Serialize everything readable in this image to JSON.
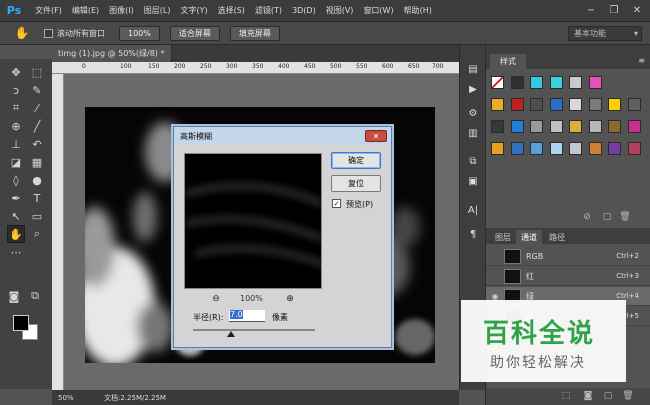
{
  "app": {
    "logo": "Ps"
  },
  "menu": [
    "文件(F)",
    "编辑(E)",
    "图像(I)",
    "图层(L)",
    "文字(Y)",
    "选择(S)",
    "滤镜(T)",
    "3D(D)",
    "视图(V)",
    "窗口(W)",
    "帮助(H)"
  ],
  "window_controls": {
    "minimize": "−",
    "restore": "❐",
    "close": "✕"
  },
  "options_bar": {
    "scroll_all_windows": "滚动所有窗口",
    "scroll_all_checked": false,
    "zoom_100": "100%",
    "fit_screen": "适合屏幕",
    "fill_screen": "填充屏幕",
    "workspace": "基本功能"
  },
  "document": {
    "tab_title": "timg (1).jpg @ 50%(绿/8) *",
    "tab_close": "×",
    "ruler_marks": [
      "0",
      "100",
      "150",
      "200",
      "250",
      "300",
      "350",
      "400",
      "450",
      "500",
      "550",
      "600",
      "650",
      "700",
      "750"
    ],
    "zoom": "50%",
    "doc_size": "文档:2.25M/2.25M"
  },
  "dialog": {
    "title": "高斯模糊",
    "close": "✕",
    "ok": "确定",
    "reset": "复位",
    "preview_label": "预览(P)",
    "preview_checked": true,
    "zoom_percent": "100%",
    "radius_label": "半径(R):",
    "radius_value": "7.0",
    "radius_unit": "像素"
  },
  "styles_panel": {
    "tab": "样式",
    "menu_icon": "≡",
    "swatch_colors": [
      "#ffffff",
      "#303030",
      "#36c6e8",
      "#3fd0e0",
      "#c9c9c9",
      "#e84fb8",
      "#e8b020",
      "#c02020",
      "#4f4f4f",
      "#2a6fc8",
      "#d8d8d8",
      "#7a7a7a",
      "#ffd000",
      "#606060",
      "#383838",
      "#2080d8",
      "#9a9a9a",
      "#c0c0c0",
      "#d8b040",
      "#b8b8b8",
      "#8a6a30",
      "#c83090",
      "#e8a020",
      "#3070c0",
      "#5aa0d8",
      "#a8d8f0",
      "#c0c8d0",
      "#d08030",
      "#7040a0",
      "#b04060"
    ]
  },
  "channels_panel": {
    "tabs": [
      "图层",
      "通道",
      "路径"
    ],
    "active_tab": 1,
    "channels": [
      {
        "name": "RGB",
        "shortcut": "Ctrl+2",
        "visible": false
      },
      {
        "name": "红",
        "shortcut": "Ctrl+3",
        "visible": false
      },
      {
        "name": "绿",
        "shortcut": "Ctrl+4",
        "visible": true
      },
      {
        "name": "蓝",
        "shortcut": "Ctrl+5",
        "visible": false
      }
    ]
  },
  "watermark": {
    "title": "百科全说",
    "subtitle": "助你轻松解决"
  }
}
